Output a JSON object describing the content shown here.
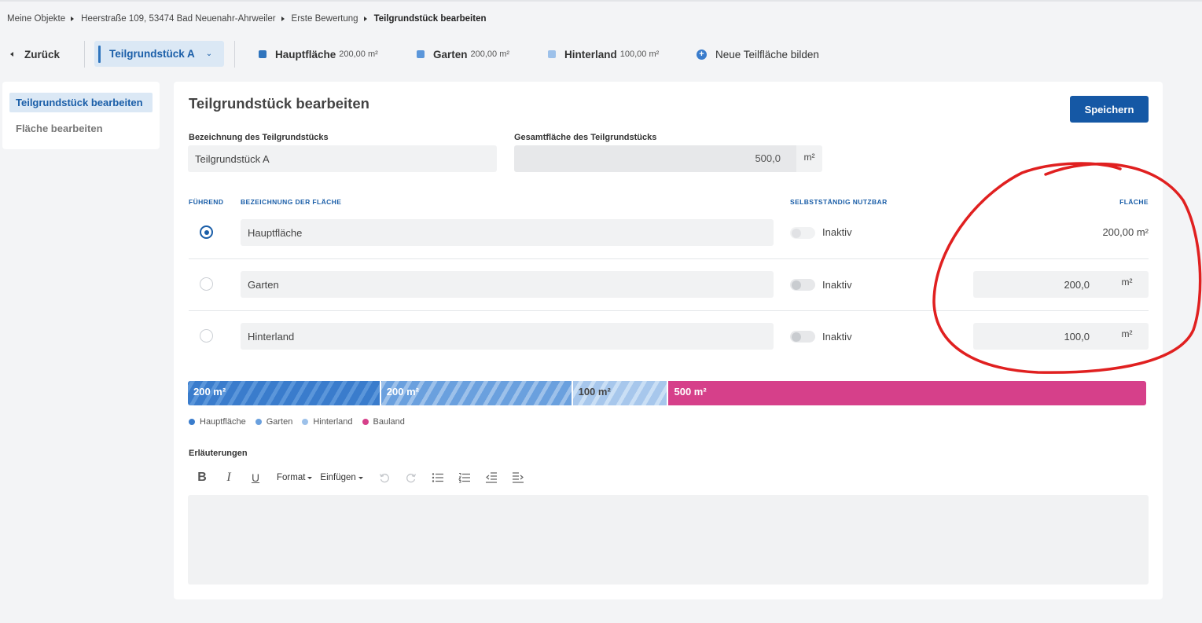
{
  "breadcrumb": {
    "items": [
      "Meine Objekte",
      "Heerstraße 109, 53474 Bad Neuenahr-Ahrweiler",
      "Erste Bewertung"
    ],
    "current": "Teilgrundstück bearbeiten"
  },
  "tabbar": {
    "back_label": "Zurück",
    "selector_label": "Teilgrundstück A",
    "tabs": [
      {
        "name": "Hauptfläche",
        "size": "200,00 m²",
        "color": "#2f74bd"
      },
      {
        "name": "Garten",
        "size": "200,00 m²",
        "color": "#5b96da"
      },
      {
        "name": "Hinterland",
        "size": "100,00 m²",
        "color": "#9dc1ea"
      }
    ],
    "new_area_label": "Neue Teilfläche bilden"
  },
  "sidebar": {
    "items": [
      {
        "label": "Teilgrundstück bearbeiten",
        "active": true
      },
      {
        "label": "Fläche bearbeiten",
        "active": false
      }
    ]
  },
  "form": {
    "title": "Teilgrundstück bearbeiten",
    "save_label": "Speichern",
    "name_label": "Bezeichnung des Teilgrundstücks",
    "name_value": "Teilgrundstück A",
    "total_label": "Gesamtfläche des Teilgrundstücks",
    "total_value": "500,0",
    "total_unit": "m²"
  },
  "table": {
    "headers": {
      "leading": "FÜHREND",
      "name": "BEZEICHNUNG DER FLÄCHE",
      "usable": "SELBSTSTÄNDIG NUTZBAR",
      "area": "FLÄCHE"
    },
    "rows": [
      {
        "name": "Hauptfläche",
        "leading": true,
        "status": "Inaktiv",
        "area_text": "200,00 m²"
      },
      {
        "name": "Garten",
        "leading": false,
        "status": "Inaktiv",
        "area_value": "200,0",
        "unit": "m²"
      },
      {
        "name": "Hinterland",
        "leading": false,
        "status": "Inaktiv",
        "area_value": "100,0",
        "unit": "m²"
      }
    ]
  },
  "bar": {
    "segments": [
      {
        "label": "200 m²",
        "value": 200
      },
      {
        "label": "200 m²",
        "value": 200
      },
      {
        "label": "100 m²",
        "value": 100
      },
      {
        "label": "500 m²",
        "value": 500
      }
    ]
  },
  "legend": [
    {
      "label": "Hauptfläche",
      "color": "#3a7ccc"
    },
    {
      "label": "Garten",
      "color": "#6aa0de"
    },
    {
      "label": "Hinterland",
      "color": "#9dc1ea"
    },
    {
      "label": "Bauland",
      "color": "#d6408a"
    }
  ],
  "editor": {
    "label": "Erläuterungen",
    "toolbar": {
      "bold": "B",
      "italic": "I",
      "underline": "U",
      "format": "Format",
      "insert": "Einfügen"
    }
  },
  "colors": {
    "accent": "#1a5ea8",
    "primary_button": "#1558a5",
    "bauland": "#d6408a",
    "annotation": "#e02020"
  }
}
